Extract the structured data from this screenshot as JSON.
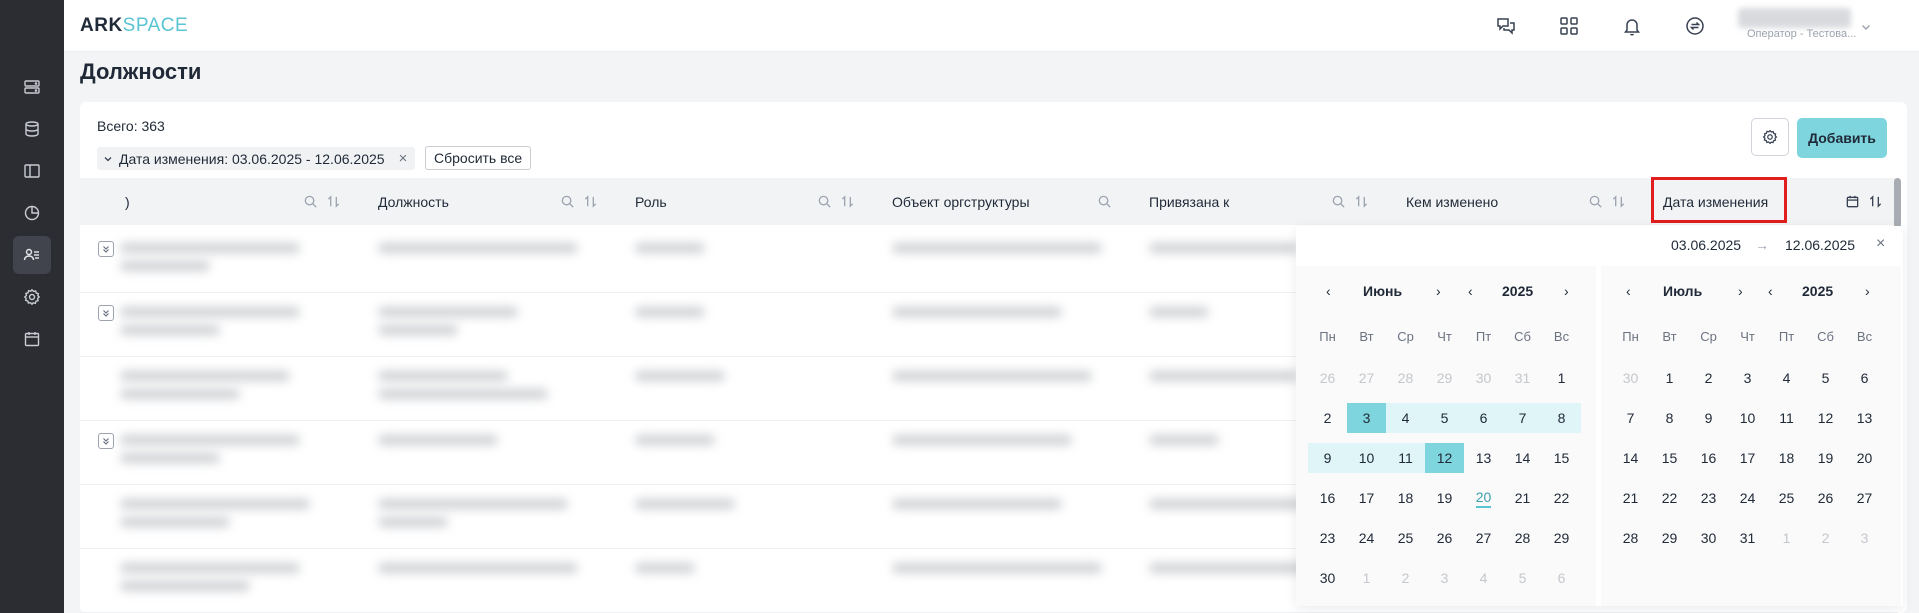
{
  "app": {
    "logo_part1": "ARK",
    "logo_part2": "SPACE"
  },
  "sidebar": {
    "items": [
      {
        "name": "servers-icon"
      },
      {
        "name": "database-icon"
      },
      {
        "name": "panel-icon"
      },
      {
        "name": "chart-icon"
      },
      {
        "name": "users-icon",
        "active": true
      },
      {
        "name": "settings-icon"
      },
      {
        "name": "calendar-icon"
      }
    ]
  },
  "header": {
    "user_role": "Оператор - Тестова...",
    "icons": [
      "support-chat-icon",
      "apps-grid-icon",
      "bell-icon",
      "sync-icon"
    ]
  },
  "page": {
    "title": "Должности"
  },
  "toolbar": {
    "total": "Всего: 363",
    "filter_chip": "Дата изменения: 03.06.2025 - 12.06.2025",
    "reset_label": "Сбросить все",
    "add_label": "Добавить"
  },
  "table": {
    "columns": [
      {
        "label": ")"
      },
      {
        "label": "Должность"
      },
      {
        "label": "Роль"
      },
      {
        "label": "Объект оргструктуры"
      },
      {
        "label": "Привязана к"
      },
      {
        "label": "Кем изменено"
      },
      {
        "label": "Дата изменения"
      }
    ]
  },
  "datepicker": {
    "start": "03.06.2025",
    "arrow": "→",
    "end": "12.06.2025",
    "clear": "×",
    "weekdays": [
      "Пн",
      "Вт",
      "Ср",
      "Чт",
      "Пт",
      "Сб",
      "Вс"
    ],
    "left": {
      "month": "Июнь",
      "year": "2025",
      "weeks": [
        [
          "26",
          "27",
          "28",
          "29",
          "30",
          "31",
          "1"
        ],
        [
          "2",
          "3",
          "4",
          "5",
          "6",
          "7",
          "8"
        ],
        [
          "9",
          "10",
          "11",
          "12",
          "13",
          "14",
          "15"
        ],
        [
          "16",
          "17",
          "18",
          "19",
          "20",
          "21",
          "22"
        ],
        [
          "23",
          "24",
          "25",
          "26",
          "27",
          "28",
          "29"
        ],
        [
          "30",
          "1",
          "2",
          "3",
          "4",
          "5",
          "6"
        ]
      ]
    },
    "right": {
      "month": "Июль",
      "year": "2025",
      "weeks": [
        [
          "30",
          "1",
          "2",
          "3",
          "4",
          "5",
          "6"
        ],
        [
          "7",
          "8",
          "9",
          "10",
          "11",
          "12",
          "13"
        ],
        [
          "14",
          "15",
          "16",
          "17",
          "18",
          "19",
          "20"
        ],
        [
          "21",
          "22",
          "23",
          "24",
          "25",
          "26",
          "27"
        ],
        [
          "28",
          "29",
          "30",
          "31",
          "1",
          "2",
          "3"
        ]
      ]
    }
  }
}
